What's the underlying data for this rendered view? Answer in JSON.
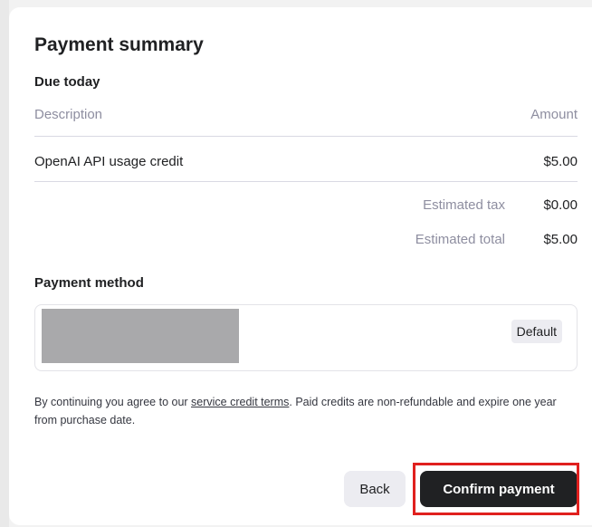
{
  "dialog": {
    "title": "Payment summary",
    "due_today_label": "Due today"
  },
  "table": {
    "columns": [
      "Description",
      "Amount"
    ],
    "items": [
      {
        "description": "OpenAI API usage credit",
        "amount": "$5.00"
      }
    ],
    "summary": [
      {
        "label": "Estimated tax",
        "value": "$0.00"
      },
      {
        "label": "Estimated total",
        "value": "$5.00"
      }
    ]
  },
  "payment_method": {
    "label": "Payment method",
    "default_badge": "Default"
  },
  "terms": {
    "prefix": "By continuing you agree to our ",
    "link_text": "service credit terms",
    "suffix": ". Paid credits are non-refundable and expire one year from purchase date."
  },
  "actions": {
    "back_label": "Back",
    "confirm_label": "Confirm payment"
  },
  "colors": {
    "confirm_bg": "#202123",
    "highlight": "#e0201e",
    "redacted": "#a9a9ab"
  }
}
